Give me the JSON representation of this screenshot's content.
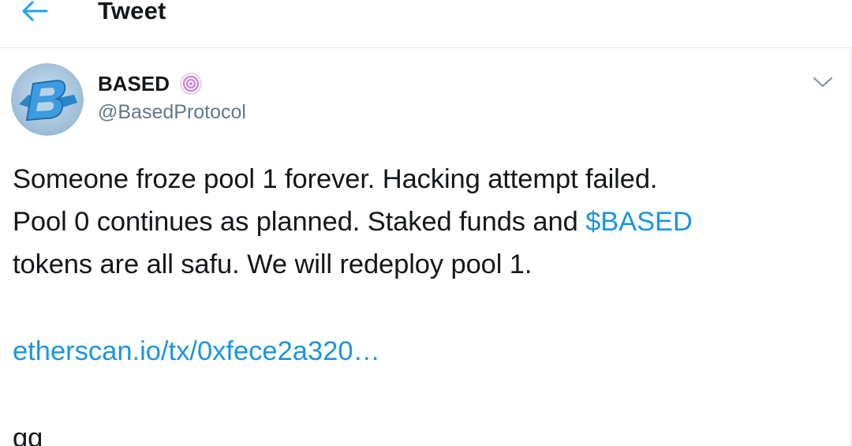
{
  "header": {
    "title": "Tweet",
    "back_icon": "arrow-left-icon",
    "accent": "#1da1f2"
  },
  "author": {
    "name": "BASED",
    "handle": "@BasedProtocol",
    "badge_icon": "sushi-emoji-icon",
    "avatar_letter": "B"
  },
  "tweet": {
    "line1": "Someone froze pool 1 forever. Hacking attempt failed.",
    "line2_prefix": "Pool 0 continues as planned. Staked funds and ",
    "cashtag": "$BASED",
    "line3": "tokens are all safu. We will redeploy pool 1.",
    "url": "etherscan.io/tx/0xfece2a320…",
    "closing": "gg"
  },
  "colors": {
    "link": "#1b95e0",
    "text": "#14171a",
    "secondary": "#657786",
    "divider": "#e6ecf0"
  }
}
